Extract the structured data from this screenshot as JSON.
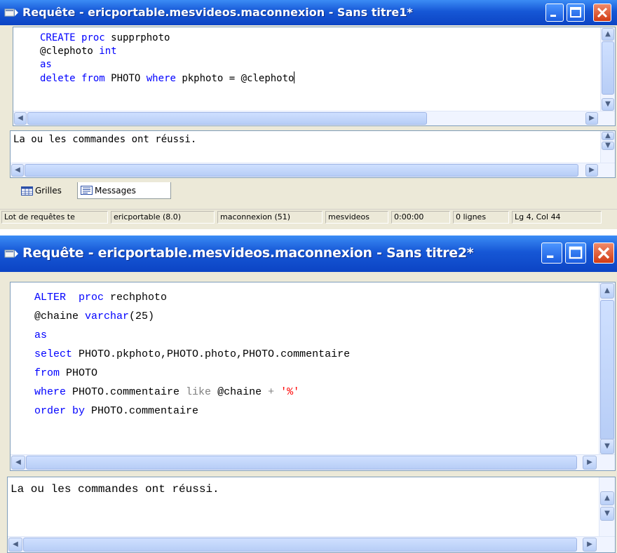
{
  "windows": [
    {
      "title": "Requête - ericportable.mesvideos.maconnexion - Sans titre1*",
      "code_lines": [
        "CREATE proc supprphoto",
        "@clephoto int",
        "as",
        "delete from PHOTO where pkphoto = @clephoto"
      ],
      "message": "La ou les commandes ont réussi.",
      "tabs": {
        "grids": "Grilles",
        "messages": "Messages"
      },
      "status": {
        "batch": "Lot de requêtes te",
        "server": "ericportable (8.0)",
        "connection": "maconnexion (51)",
        "database": "mesvideos",
        "elapsed": "0:00:00",
        "rows": "0 lignes",
        "position": "Lg 4, Col 44"
      }
    },
    {
      "title": "Requête - ericportable.mesvideos.maconnexion - Sans titre2*",
      "code_lines": [
        "ALTER  proc rechphoto",
        "@chaine varchar(25)",
        "as",
        "select PHOTO.pkphoto,PHOTO.photo,PHOTO.commentaire",
        "from PHOTO",
        "where PHOTO.commentaire like @chaine + '%'",
        "order by PHOTO.commentaire"
      ],
      "message": "La ou les commandes ont réussi."
    }
  ],
  "colors": {
    "titlebar": "#0c44c4",
    "keyword": "#0000ff",
    "function": "#808080",
    "string": "#ff0000",
    "window_face": "#ece9d8"
  },
  "icons": [
    "query-window-icon",
    "minimize-icon",
    "maximize-icon",
    "close-icon",
    "grid-icon",
    "messages-icon",
    "scroll-up-icon",
    "scroll-down-icon",
    "scroll-left-icon",
    "scroll-right-icon"
  ]
}
